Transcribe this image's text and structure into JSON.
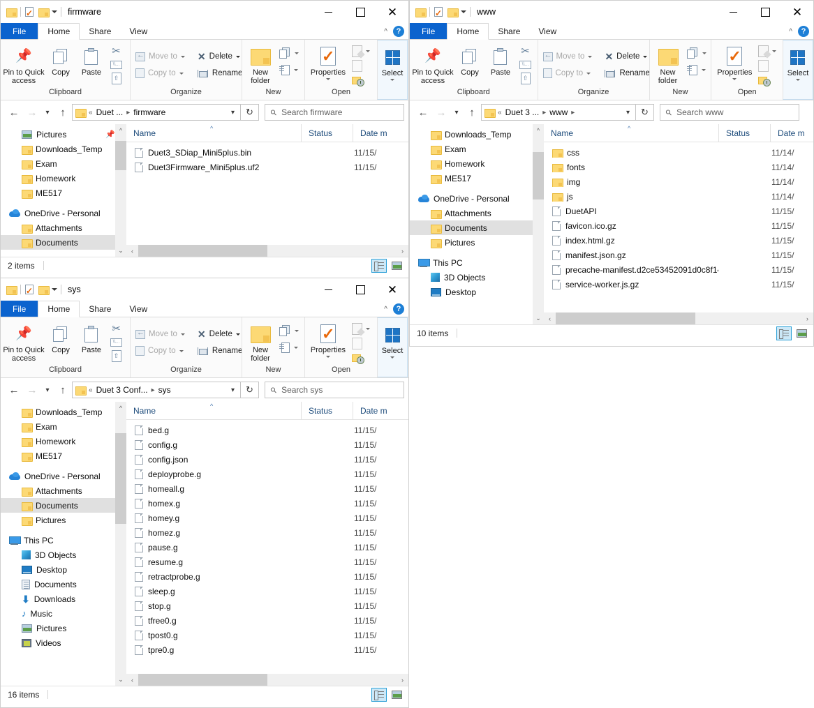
{
  "ribbon": {
    "tabs": [
      "File",
      "Home",
      "Share",
      "View"
    ],
    "groups": {
      "clipboard": {
        "label": "Clipboard",
        "pin": "Pin to Quick\naccess",
        "pin_line1": "Pin to Quick",
        "pin_line2": "access",
        "copy": "Copy",
        "paste": "Paste"
      },
      "organize": {
        "label": "Organize",
        "move_to": "Move to",
        "copy_to": "Copy to",
        "delete": "Delete",
        "rename": "Rename"
      },
      "new": {
        "label": "New",
        "new_folder_line1": "New",
        "new_folder_line2": "folder"
      },
      "open": {
        "label": "Open",
        "properties": "Properties"
      },
      "select": {
        "label": "Select"
      }
    }
  },
  "columns": {
    "name": "Name",
    "status": "Status",
    "date": "Date m"
  },
  "windows": [
    {
      "id": "firmware",
      "title": "firmware",
      "breadcrumb": [
        "Duet ...",
        "firmware"
      ],
      "breadcrumb_trailing": false,
      "search_placeholder": "Search firmware",
      "status": "2 items",
      "nav_items": [
        {
          "label": "Pictures",
          "icon": "pictures-icon",
          "indent": 1,
          "pinned": true,
          "selected": false
        },
        {
          "label": "Downloads_Temp",
          "icon": "folder-icon",
          "indent": 1,
          "selected": false
        },
        {
          "label": "Exam",
          "icon": "folder-icon",
          "indent": 1,
          "selected": false
        },
        {
          "label": "Homework",
          "icon": "folder-icon",
          "indent": 1,
          "selected": false
        },
        {
          "label": "ME517",
          "icon": "folder-icon",
          "indent": 1,
          "selected": false
        },
        {
          "label": "__GAP__"
        },
        {
          "label": "OneDrive - Personal",
          "icon": "onedrive-icon",
          "indent": 0,
          "selected": false
        },
        {
          "label": "Attachments",
          "icon": "folder-icon",
          "indent": 1,
          "selected": false
        },
        {
          "label": "Documents",
          "icon": "folder-icon",
          "indent": 1,
          "selected": true
        }
      ],
      "files": [
        {
          "name": "Duet3_SDiap_Mini5plus.bin",
          "icon": "file-icon",
          "status": "",
          "date": "11/15/"
        },
        {
          "name": "Duet3Firmware_Mini5plus.uf2",
          "icon": "file-icon",
          "status": "",
          "date": "11/15/"
        }
      ]
    },
    {
      "id": "www",
      "title": "www",
      "breadcrumb": [
        "Duet 3 ...",
        "www"
      ],
      "breadcrumb_trailing": true,
      "search_placeholder": "Search www",
      "status": "10 items",
      "nav_items": [
        {
          "label": "Downloads_Temp",
          "icon": "folder-icon",
          "indent": 1,
          "selected": false
        },
        {
          "label": "Exam",
          "icon": "folder-icon",
          "indent": 1,
          "selected": false
        },
        {
          "label": "Homework",
          "icon": "folder-icon",
          "indent": 1,
          "selected": false
        },
        {
          "label": "ME517",
          "icon": "folder-icon",
          "indent": 1,
          "selected": false
        },
        {
          "label": "__GAP__"
        },
        {
          "label": "OneDrive - Personal",
          "icon": "onedrive-icon",
          "indent": 0,
          "selected": false
        },
        {
          "label": "Attachments",
          "icon": "folder-icon",
          "indent": 1,
          "selected": false
        },
        {
          "label": "Documents",
          "icon": "folder-icon",
          "indent": 1,
          "selected": true
        },
        {
          "label": "Pictures",
          "icon": "folder-icon",
          "indent": 1,
          "selected": false
        },
        {
          "label": "__GAP__"
        },
        {
          "label": "This PC",
          "icon": "pc-icon",
          "indent": 0,
          "selected": false
        },
        {
          "label": "3D Objects",
          "icon": "3dobjects-icon",
          "indent": 1,
          "selected": false
        },
        {
          "label": "Desktop",
          "icon": "desktop-icon",
          "indent": 1,
          "selected": false
        }
      ],
      "files": [
        {
          "name": "css",
          "icon": "folder-icon",
          "status": "",
          "date": "11/14/"
        },
        {
          "name": "fonts",
          "icon": "folder-icon",
          "status": "",
          "date": "11/14/"
        },
        {
          "name": "img",
          "icon": "folder-icon",
          "status": "",
          "date": "11/14/"
        },
        {
          "name": "js",
          "icon": "folder-icon",
          "status": "",
          "date": "11/14/"
        },
        {
          "name": "DuetAPI",
          "icon": "file-icon",
          "status": "",
          "date": "11/15/"
        },
        {
          "name": "favicon.ico.gz",
          "icon": "file-icon",
          "status": "",
          "date": "11/15/"
        },
        {
          "name": "index.html.gz",
          "icon": "file-icon",
          "status": "",
          "date": "11/15/"
        },
        {
          "name": "manifest.json.gz",
          "icon": "file-icon",
          "status": "",
          "date": "11/15/"
        },
        {
          "name": "precache-manifest.d2ce53452091d0c8f14...",
          "icon": "file-icon",
          "status": "",
          "date": "11/15/"
        },
        {
          "name": "service-worker.js.gz",
          "icon": "file-icon",
          "status": "",
          "date": "11/15/"
        }
      ]
    },
    {
      "id": "sys",
      "title": "sys",
      "breadcrumb": [
        "Duet 3 Conf...",
        "sys"
      ],
      "breadcrumb_trailing": false,
      "search_placeholder": "Search sys",
      "status": "16 items",
      "nav_items": [
        {
          "label": "Downloads_Temp",
          "icon": "folder-icon",
          "indent": 1,
          "selected": false
        },
        {
          "label": "Exam",
          "icon": "folder-icon",
          "indent": 1,
          "selected": false
        },
        {
          "label": "Homework",
          "icon": "folder-icon",
          "indent": 1,
          "selected": false
        },
        {
          "label": "ME517",
          "icon": "folder-icon",
          "indent": 1,
          "selected": false
        },
        {
          "label": "__GAP__"
        },
        {
          "label": "OneDrive - Personal",
          "icon": "onedrive-icon",
          "indent": 0,
          "selected": false
        },
        {
          "label": "Attachments",
          "icon": "folder-icon",
          "indent": 1,
          "selected": false
        },
        {
          "label": "Documents",
          "icon": "folder-icon",
          "indent": 1,
          "selected": true
        },
        {
          "label": "Pictures",
          "icon": "folder-icon",
          "indent": 1,
          "selected": false
        },
        {
          "label": "__GAP__"
        },
        {
          "label": "This PC",
          "icon": "pc-icon",
          "indent": 0,
          "selected": false
        },
        {
          "label": "3D Objects",
          "icon": "3dobjects-icon",
          "indent": 1,
          "selected": false
        },
        {
          "label": "Desktop",
          "icon": "desktop-icon",
          "indent": 1,
          "selected": false
        },
        {
          "label": "Documents",
          "icon": "documents-icon",
          "indent": 1,
          "selected": false
        },
        {
          "label": "Downloads",
          "icon": "downloads-icon",
          "indent": 1,
          "selected": false
        },
        {
          "label": "Music",
          "icon": "music-icon",
          "indent": 1,
          "selected": false
        },
        {
          "label": "Pictures",
          "icon": "pictures-icon",
          "indent": 1,
          "selected": false
        },
        {
          "label": "Videos",
          "icon": "videos-icon",
          "indent": 1,
          "selected": false
        }
      ],
      "files": [
        {
          "name": "bed.g",
          "icon": "file-icon",
          "status": "",
          "date": "11/15/"
        },
        {
          "name": "config.g",
          "icon": "file-icon",
          "status": "",
          "date": "11/15/"
        },
        {
          "name": "config.json",
          "icon": "file-icon",
          "status": "",
          "date": "11/15/"
        },
        {
          "name": "deployprobe.g",
          "icon": "file-icon",
          "status": "",
          "date": "11/15/"
        },
        {
          "name": "homeall.g",
          "icon": "file-icon",
          "status": "",
          "date": "11/15/"
        },
        {
          "name": "homex.g",
          "icon": "file-icon",
          "status": "",
          "date": "11/15/"
        },
        {
          "name": "homey.g",
          "icon": "file-icon",
          "status": "",
          "date": "11/15/"
        },
        {
          "name": "homez.g",
          "icon": "file-icon",
          "status": "",
          "date": "11/15/"
        },
        {
          "name": "pause.g",
          "icon": "file-icon",
          "status": "",
          "date": "11/15/"
        },
        {
          "name": "resume.g",
          "icon": "file-icon",
          "status": "",
          "date": "11/15/"
        },
        {
          "name": "retractprobe.g",
          "icon": "file-icon",
          "status": "",
          "date": "11/15/"
        },
        {
          "name": "sleep.g",
          "icon": "file-icon",
          "status": "",
          "date": "11/15/"
        },
        {
          "name": "stop.g",
          "icon": "file-icon",
          "status": "",
          "date": "11/15/"
        },
        {
          "name": "tfree0.g",
          "icon": "file-icon",
          "status": "",
          "date": "11/15/"
        },
        {
          "name": "tpost0.g",
          "icon": "file-icon",
          "status": "",
          "date": "11/15/"
        },
        {
          "name": "tpre0.g",
          "icon": "file-icon",
          "status": "",
          "date": "11/15/"
        }
      ]
    }
  ],
  "colors": {
    "file_tab_blue": "#0b63ce",
    "folder_yellow": "#fcd975",
    "selection_gray": "#e0e0e0",
    "help_blue": "#1d7fd6",
    "column_header_text": "#1b4a7a"
  }
}
